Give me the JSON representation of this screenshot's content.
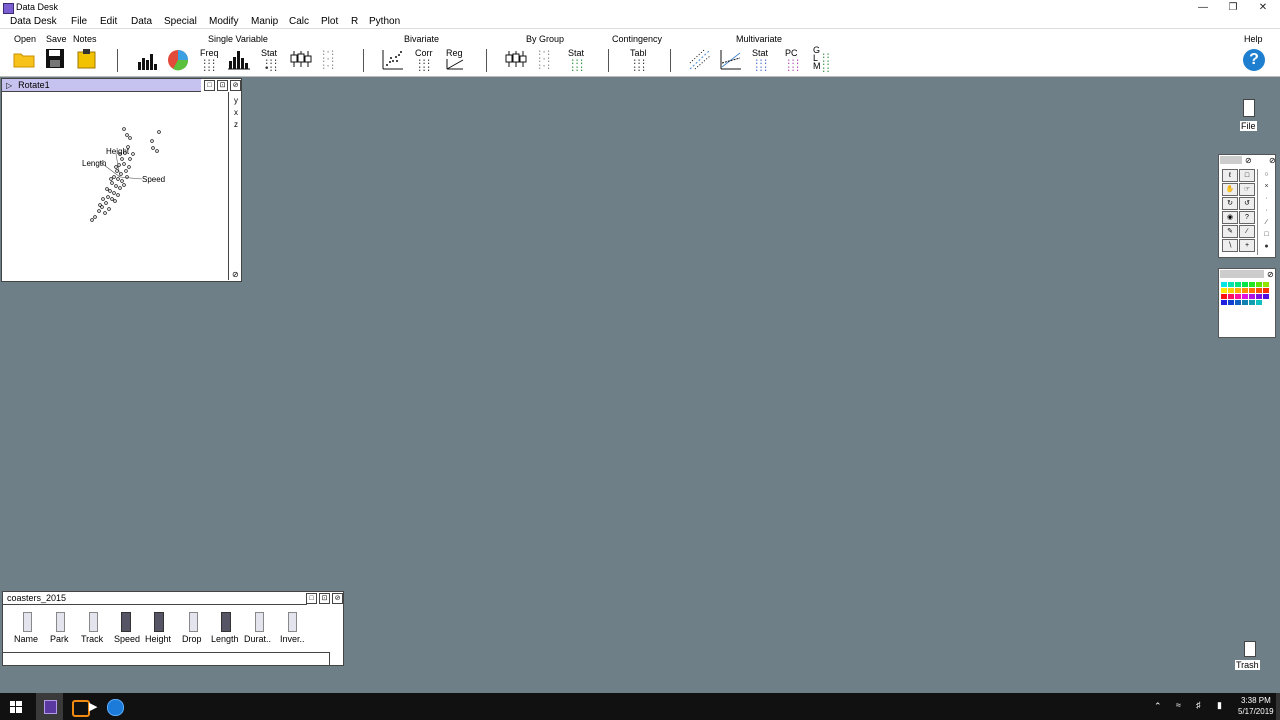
{
  "window": {
    "title": "Data Desk",
    "minimize": "—",
    "maximize": "❐",
    "close": "✕"
  },
  "menu": [
    "Data Desk",
    "File",
    "Edit",
    "Data",
    "Special",
    "Modify",
    "Manip",
    "Calc",
    "Plot",
    "R",
    "Python"
  ],
  "toolbar": {
    "open": "Open",
    "save": "Save",
    "notes": "Notes",
    "groups": {
      "single_variable": "Single Variable",
      "bivariate": "Bivariate",
      "by_group": "By Group",
      "contingency": "Contingency",
      "multivariate": "Multivariate",
      "help": "Help"
    },
    "sv_freq": "Freq",
    "sv_stat": "Stat",
    "bv_corr": "Corr",
    "bv_reg": "Reg",
    "bg_stat": "Stat",
    "ct_tabl": "Tabl",
    "mv_stat": "Stat",
    "mv_pc": "PC",
    "mv_glm": "G\nL\nM",
    "help_glyph": "?"
  },
  "rotate_window": {
    "title": "Rotate1",
    "axis_labels": [
      "y",
      "x",
      "z"
    ],
    "var_labels": {
      "height": "Height",
      "length": "Length",
      "speed": "Speed"
    }
  },
  "dataset_window": {
    "title": "coasters_2015",
    "variables": [
      "Name",
      "Park",
      "Track",
      "Speed",
      "Height",
      "Drop",
      "Length",
      "Durat..",
      "Inver.."
    ]
  },
  "right_panel": {
    "file_label": "File",
    "trash_label": "Trash"
  },
  "palette_colors": [
    "#00e5e5",
    "#00e5b0",
    "#00e57a",
    "#00e545",
    "#22e522",
    "#5be500",
    "#92e500",
    "#ffe500",
    "#ffd000",
    "#ffb000",
    "#ff9000",
    "#ff7000",
    "#ff5000",
    "#ff3000",
    "#ff1010",
    "#ff1060",
    "#ff10a0",
    "#e010e0",
    "#b010e0",
    "#8010e0",
    "#5010e0",
    "#2020e0",
    "#1040d0",
    "#1060c0",
    "#1080b0",
    "#10a0b0",
    "#10c0c0",
    "#ffffff"
  ],
  "taskbar": {
    "time": "3:38 PM",
    "date": "5/17/2019"
  }
}
